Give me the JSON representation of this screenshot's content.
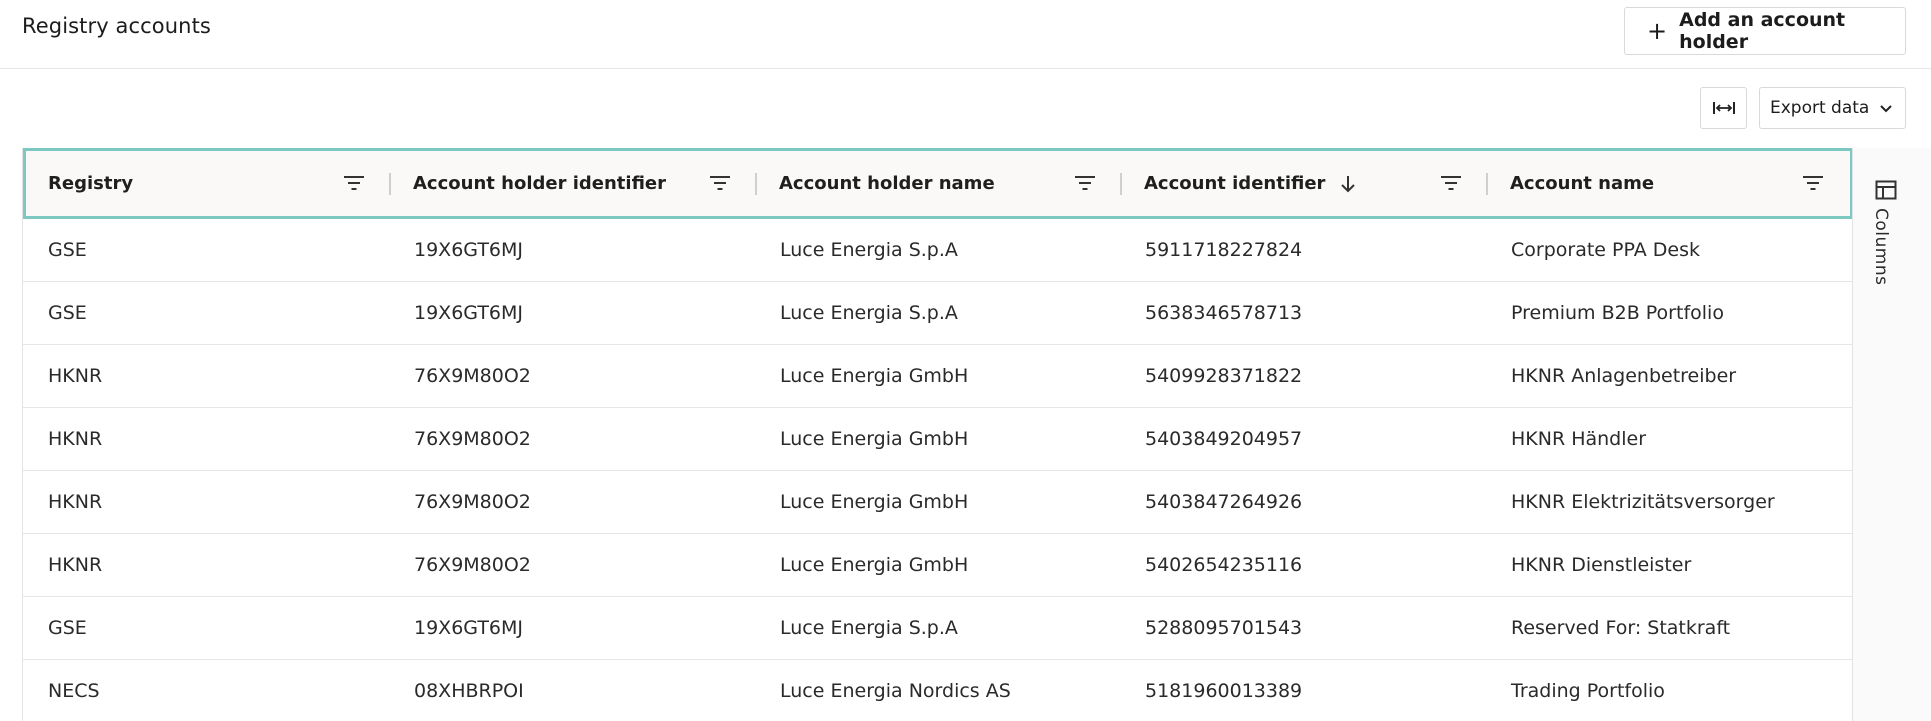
{
  "header": {
    "title": "Registry accounts",
    "add_button_label": "Add an account holder"
  },
  "toolbar": {
    "fit_columns_icon": "fit-columns-icon",
    "export_label": "Export data"
  },
  "table": {
    "columns": [
      {
        "label": "Registry",
        "sorted": null
      },
      {
        "label": "Account holder identifier",
        "sorted": null
      },
      {
        "label": "Account holder name",
        "sorted": null
      },
      {
        "label": "Account identifier",
        "sorted": "descending"
      },
      {
        "label": "Account name",
        "sorted": null
      }
    ],
    "rows": [
      [
        "GSE",
        "19X6GT6MJ",
        "Luce Energia S.p.A",
        "5911718227824",
        "Corporate PPA Desk"
      ],
      [
        "GSE",
        "19X6GT6MJ",
        "Luce Energia S.p.A",
        "5638346578713",
        "Premium B2B Portfolio"
      ],
      [
        "HKNR",
        "76X9M80O2",
        "Luce Energia GmbH",
        "5409928371822",
        "HKNR Anlagenbetreiber"
      ],
      [
        "HKNR",
        "76X9M80O2",
        "Luce Energia GmbH",
        "5403849204957",
        "HKNR Händler"
      ],
      [
        "HKNR",
        "76X9M80O2",
        "Luce Energia GmbH",
        "5403847264926",
        "HKNR Elektrizitätsversorger"
      ],
      [
        "HKNR",
        "76X9M80O2",
        "Luce Energia GmbH",
        "5402654235116",
        "HKNR Dienstleister"
      ],
      [
        "GSE",
        "19X6GT6MJ",
        "Luce Energia S.p.A",
        "5288095701543",
        "Reserved For: Statkraft"
      ],
      [
        "NECS",
        "08XHBRPOI",
        "Luce Energia Nordics AS",
        "5181960013389",
        "Trading Portfolio"
      ]
    ]
  },
  "side_panel": {
    "columns_label": "Columns"
  },
  "colors": {
    "header_focus_border": "#7dc8c0",
    "header_background": "#faf9f7",
    "row_divider": "#e6e6e6"
  }
}
